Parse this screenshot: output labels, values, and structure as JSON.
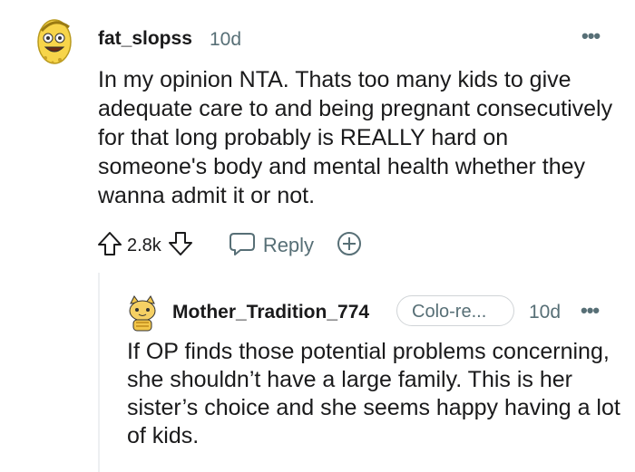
{
  "comment": {
    "username": "fat_slopss",
    "age": "10d",
    "more": "•••",
    "body": "In my opinion NTA. Thats too many kids to give adequate care to and being pregnant consecutively for that long probably is REALLY hard on someone's body and mental health whether they wanna admit it or not.",
    "vote_count": "2.8k",
    "reply_label": "Reply",
    "avatar_icon": "snoo-avatar-yellow-icon"
  },
  "reply": {
    "username": "Mother_Tradition_774",
    "flair": "Colo-re...",
    "age": "10d",
    "more": "•••",
    "body": "If OP finds those potential problems concerning, she shouldn’t have a large family. This is her sister’s choice and she seems happy having a lot of kids.",
    "avatar_icon": "snoo-avatar-cat-icon"
  },
  "colors": {
    "text": "#1a1a1b",
    "meta": "#576f76",
    "avatar_yellow": "#f7d54a",
    "thread_line": "#edeff1"
  }
}
